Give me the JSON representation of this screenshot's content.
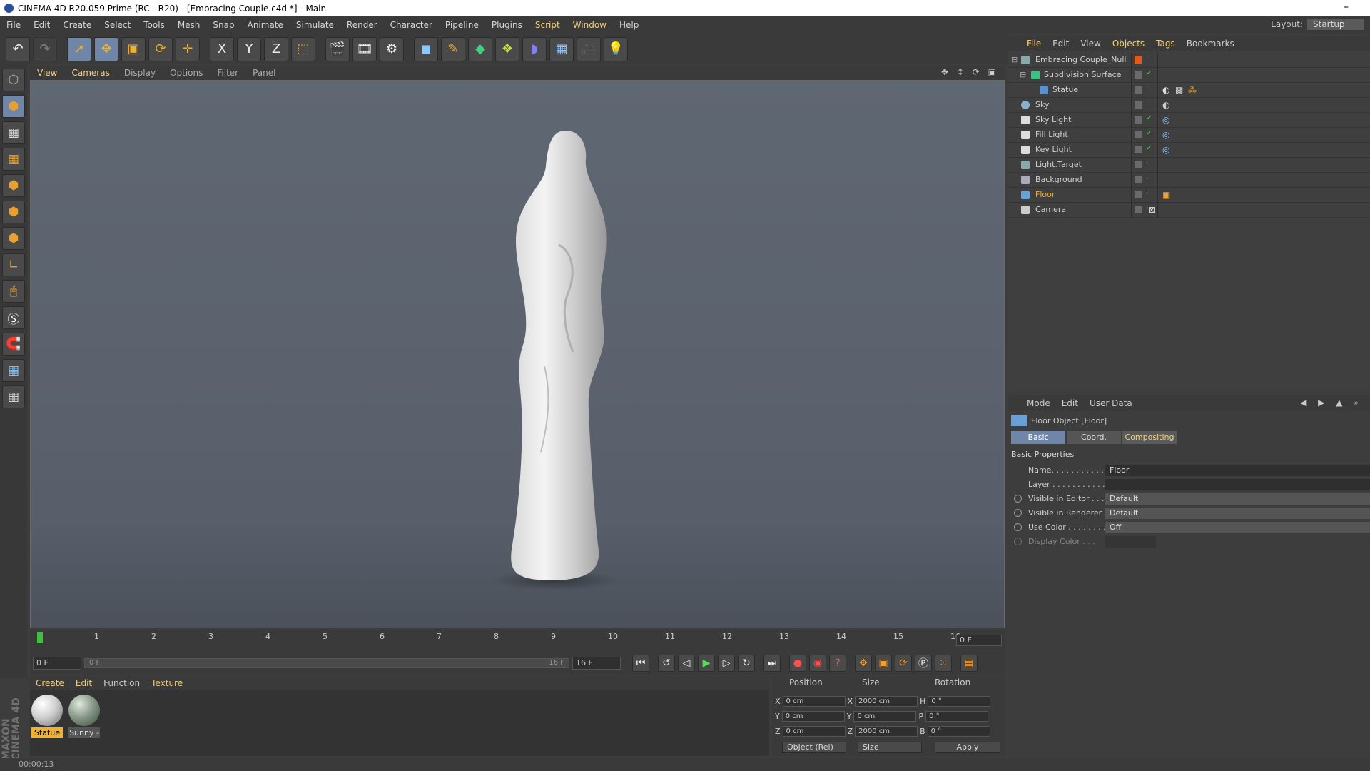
{
  "window": {
    "title": "CINEMA 4D R20.059 Prime (RC - R20) - [Embracing Couple.c4d *] - Main",
    "minimize": "–"
  },
  "menubar": {
    "items": [
      "File",
      "Edit",
      "Create",
      "Select",
      "Tools",
      "Mesh",
      "Snap",
      "Animate",
      "Simulate",
      "Render",
      "Character",
      "Pipeline",
      "Plugins",
      "Script",
      "Window",
      "Help"
    ],
    "layout_label": "Layout:",
    "layout_value": "Startup"
  },
  "toolbar": {
    "icons": [
      "undo-icon",
      "redo-icon",
      "select-live-icon",
      "move-icon",
      "scale-icon",
      "rotate-icon",
      "last-tool-icon",
      "x-axis-lock-icon",
      "y-axis-lock-icon",
      "z-axis-lock-icon",
      "coordinate-system-icon",
      "render-view-icon",
      "render-picture-viewer-icon",
      "edit-render-settings-icon",
      "cube-primitive-icon",
      "pen-spline-icon",
      "subdivision-surface-icon",
      "array-generator-icon",
      "deformer-icon",
      "floor-icon",
      "camera-icon",
      "light-icon"
    ],
    "axis_labels": [
      "X",
      "Y",
      "Z"
    ]
  },
  "viewport": {
    "menu": [
      "View",
      "Cameras",
      "Display",
      "Options",
      "Filter",
      "Panel"
    ],
    "nav_icons": "✥ ↕ ⟳ ▣"
  },
  "timeline": {
    "ticks": [
      "0",
      "1",
      "2",
      "3",
      "4",
      "5",
      "6",
      "7",
      "8",
      "9",
      "10",
      "11",
      "12",
      "13",
      "14",
      "15",
      "16"
    ],
    "current_frame": "0 F"
  },
  "transport": {
    "start_frame": "0 F",
    "range_start": "0 F",
    "range_end": "16 F",
    "end_frame": "16 F"
  },
  "material_manager": {
    "menu": [
      "Create",
      "Edit",
      "Function",
      "Texture"
    ],
    "materials": [
      {
        "label": "Statue"
      },
      {
        "label": "Sunny -"
      }
    ]
  },
  "coordinates": {
    "headers": [
      "Position",
      "Size",
      "Rotation"
    ],
    "rows": [
      {
        "pos_axis": "X",
        "pos": "0 cm",
        "size_axis": "X",
        "size": "2000 cm",
        "rot_axis": "H",
        "rot": "0 °"
      },
      {
        "pos_axis": "Y",
        "pos": "0 cm",
        "size_axis": "Y",
        "size": "0 cm",
        "rot_axis": "P",
        "rot": "0 °"
      },
      {
        "pos_axis": "Z",
        "pos": "0 cm",
        "size_axis": "Z",
        "size": "2000 cm",
        "rot_axis": "B",
        "rot": "0 °"
      }
    ],
    "mode": "Object (Rel)",
    "size_mode": "Size",
    "apply": "Apply"
  },
  "object_manager": {
    "menu": [
      "File",
      "Edit",
      "View",
      "Objects",
      "Tags",
      "Bookmarks"
    ],
    "objects": [
      {
        "name": "Embracing Couple_Null"
      },
      {
        "name": "Subdivision Surface"
      },
      {
        "name": "Statue"
      },
      {
        "name": "Sky"
      },
      {
        "name": "Sky Light"
      },
      {
        "name": "Fill Light"
      },
      {
        "name": "Key Light"
      },
      {
        "name": "Light.Target"
      },
      {
        "name": "Background"
      },
      {
        "name": "Floor"
      },
      {
        "name": "Camera"
      }
    ]
  },
  "attributes": {
    "menu": [
      "Mode",
      "Edit",
      "User Data"
    ],
    "object_title": "Floor Object [Floor]",
    "tabs": [
      "Basic",
      "Coord.",
      "Compositing"
    ],
    "section": "Basic Properties",
    "rows": [
      {
        "label": "Name. . . . . . . . . . . .",
        "value": "Floor"
      },
      {
        "label": "Layer . . . . . . . . . . . .",
        "value": ""
      },
      {
        "label": "Visible in Editor . . .",
        "value": "Default"
      },
      {
        "label": "Visible in Renderer",
        "value": "Default"
      },
      {
        "label": "Use Color . . . . . . . .",
        "value": "Off"
      },
      {
        "label": "Display Color . . .",
        "value": ""
      }
    ]
  },
  "status": {
    "time": "00:00:13"
  },
  "colors": {
    "accent": "#f0d080",
    "selected_blue": "#6f86a8",
    "viewport_bg": "#5f6773"
  }
}
